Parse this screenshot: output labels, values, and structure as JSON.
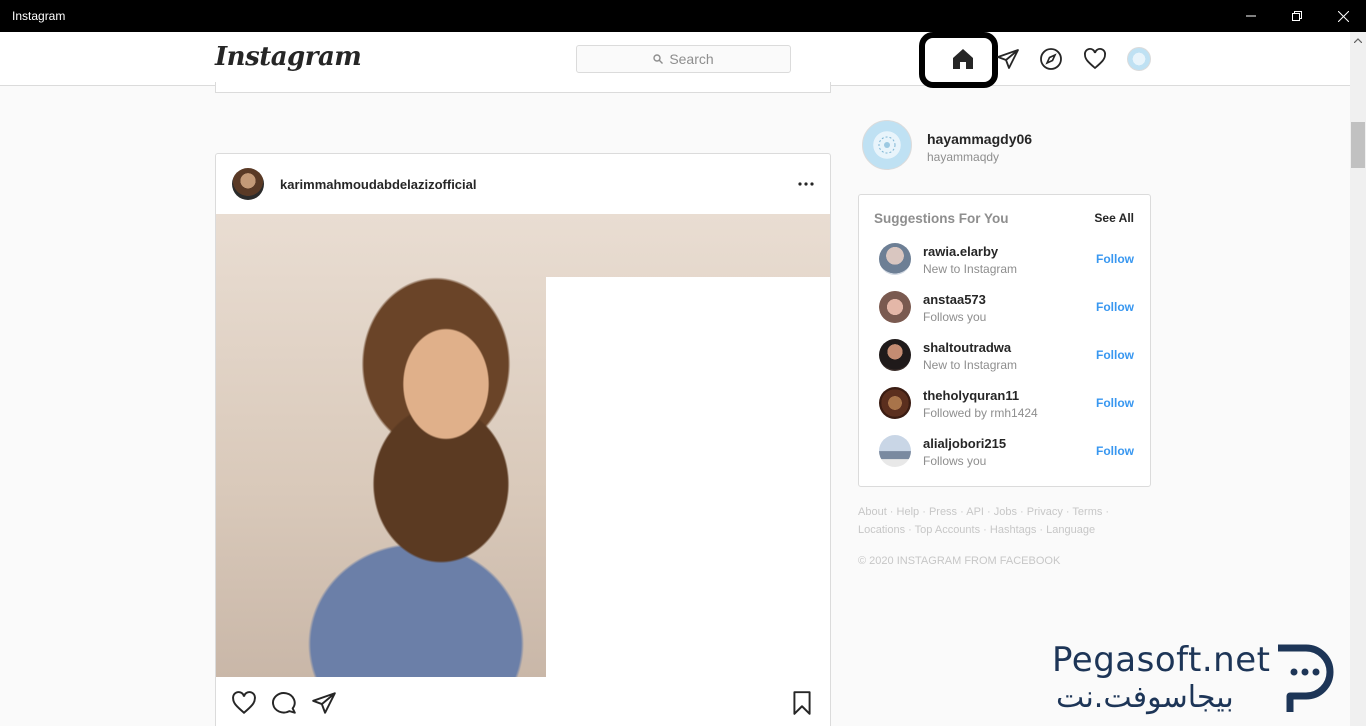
{
  "window": {
    "title": "Instagram"
  },
  "header": {
    "logo": "Instagram",
    "search_placeholder": "Search"
  },
  "post": {
    "username": "karimmahmoudabdelazizofficial"
  },
  "profile": {
    "username": "hayammagdy06",
    "fullname": "hayammaqdy"
  },
  "suggestions": {
    "title": "Suggestions For You",
    "see_all": "See All",
    "items": [
      {
        "username": "rawia.elarby",
        "subtitle": "New to Instagram",
        "action": "Follow"
      },
      {
        "username": "anstaa573",
        "subtitle": "Follows you",
        "action": "Follow"
      },
      {
        "username": "shaltoutradwa",
        "subtitle": "New to Instagram",
        "action": "Follow"
      },
      {
        "username": "theholyquran11",
        "subtitle": "Followed by rmh1424",
        "action": "Follow"
      },
      {
        "username": "alialjobori215",
        "subtitle": "Follows you",
        "action": "Follow"
      }
    ]
  },
  "footer": {
    "links": [
      "About",
      "Help",
      "Press",
      "API",
      "Jobs",
      "Privacy",
      "Terms",
      "Locations",
      "Top Accounts",
      "Hashtags",
      "Language"
    ],
    "copyright": "© 2020 INSTAGRAM FROM FACEBOOK"
  },
  "watermark": {
    "text_en": "Pegasoft.net",
    "text_ar": "بيجاسوفت.نت"
  },
  "colors": {
    "link_blue": "#3897f0",
    "border": "#dbdbdb",
    "muted": "#8e8e8e"
  }
}
